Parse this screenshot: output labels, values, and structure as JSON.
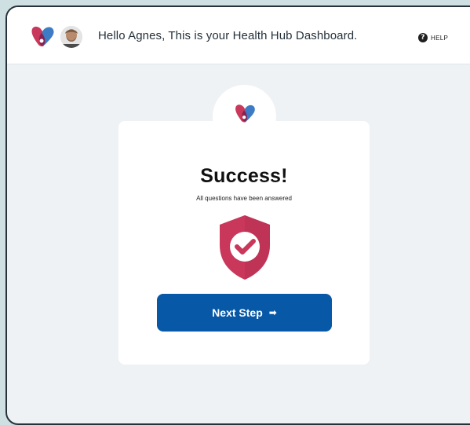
{
  "header": {
    "greeting": "Hello Agnes, This is your Health Hub Dashboard.",
    "help_label": "HELP",
    "help_icon": "question-circle-icon",
    "logo_icon": "health-hub-logo-icon",
    "avatar_icon": "user-avatar-icon"
  },
  "card": {
    "title": "Success!",
    "subtitle": "All questions have been answered",
    "shield_icon": "shield-check-icon",
    "button_label": "Next Step",
    "button_arrow": "➡"
  },
  "colors": {
    "primary": "#0758a6",
    "brand_red": "#c9375b",
    "brand_blue": "#3d7bc4",
    "background": "#eef2f4",
    "outer_background": "#cfe0e3"
  }
}
